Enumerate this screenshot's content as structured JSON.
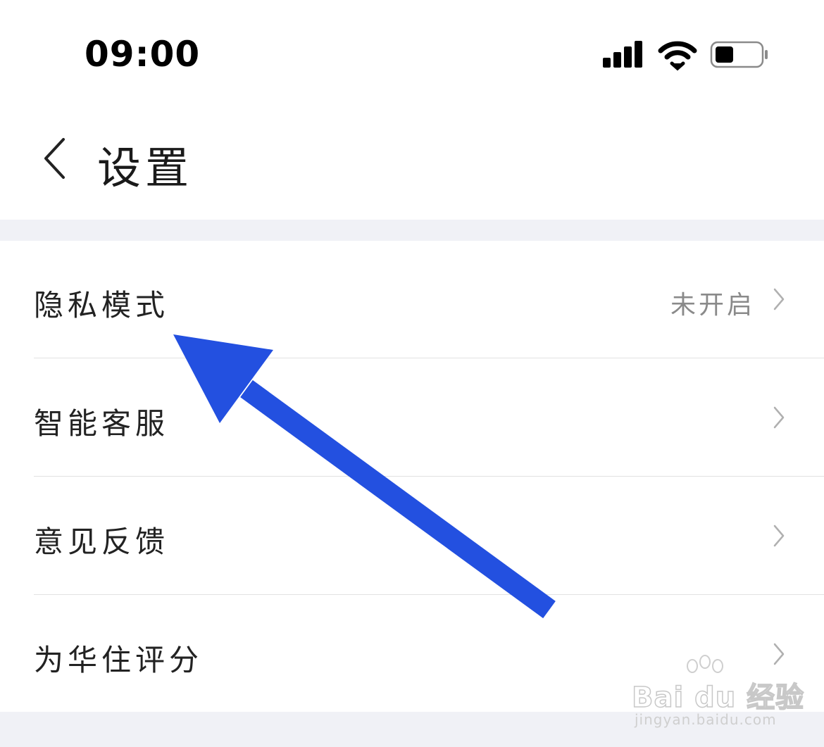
{
  "status_bar": {
    "time": "09:00",
    "icons": [
      "signal-icon",
      "wifi-icon",
      "battery-icon"
    ]
  },
  "nav": {
    "title": "设置",
    "back_icon": "chevron-left-icon"
  },
  "settings": [
    {
      "label": "隐私模式",
      "value": "未开启"
    },
    {
      "label": "智能客服",
      "value": ""
    },
    {
      "label": "意见反馈",
      "value": ""
    },
    {
      "label": "为华住评分",
      "value": ""
    }
  ],
  "annotation": {
    "type": "arrow",
    "color": "#2350e0"
  },
  "watermark": {
    "logo": "Bai du 经验",
    "url": "jingyan.baidu.com"
  },
  "colors": {
    "background": "#ffffff",
    "section_gap": "#f0f1f6",
    "secondary_text": "#8a8a8a",
    "arrow": "#2350e0"
  }
}
